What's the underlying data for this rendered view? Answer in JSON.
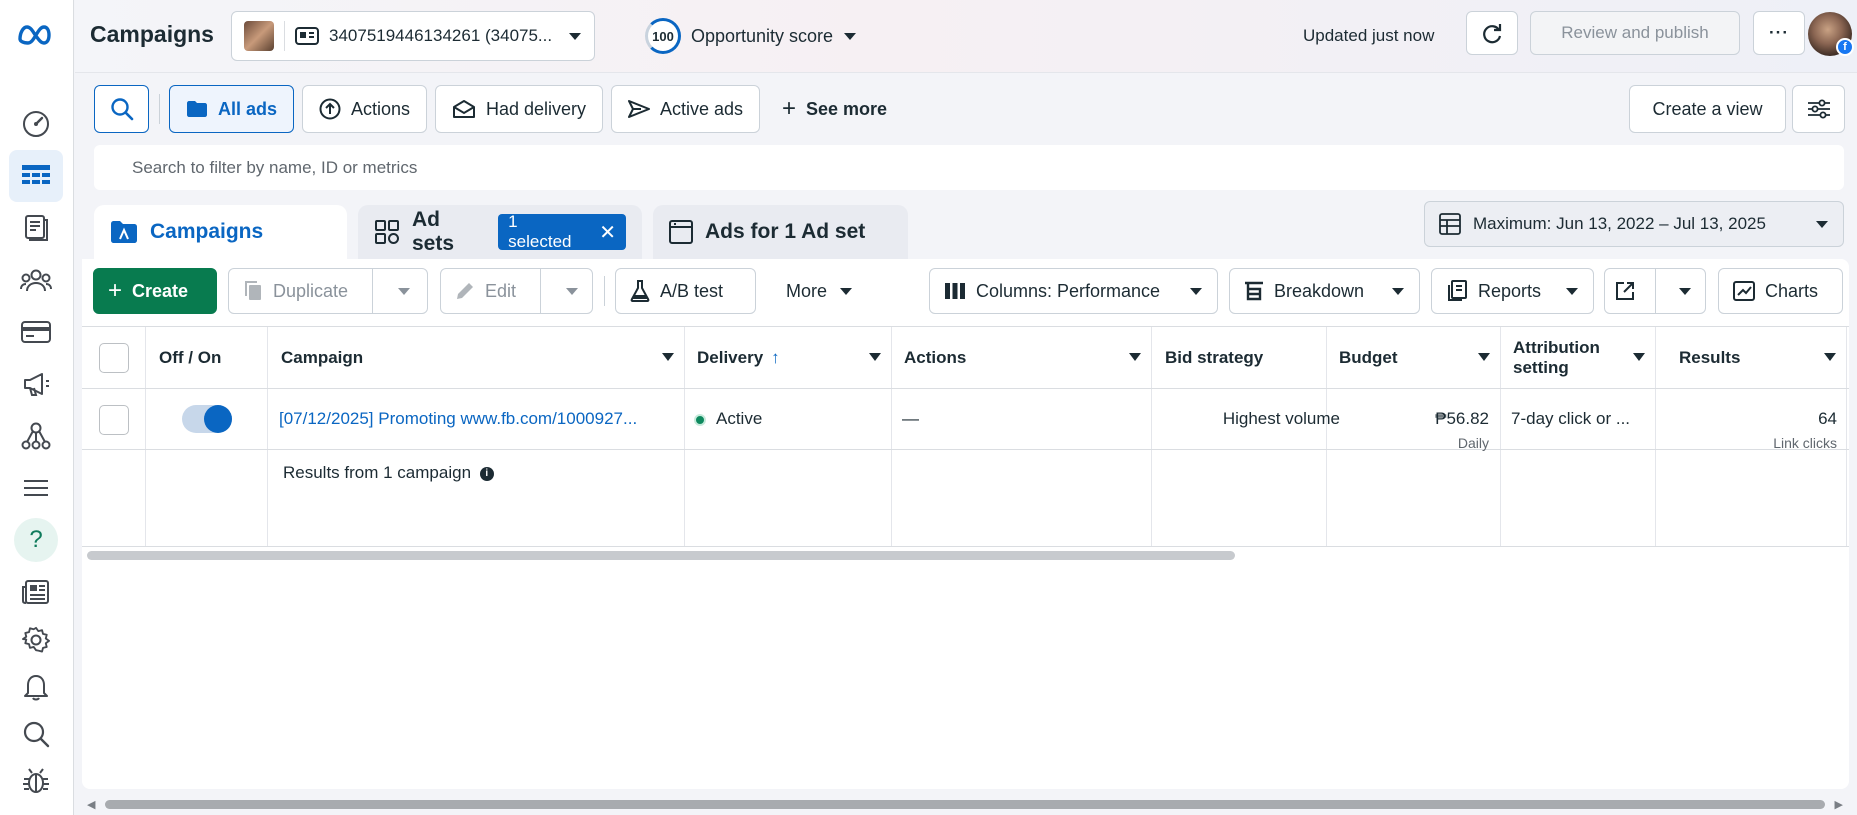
{
  "header": {
    "title": "Campaigns",
    "account_id": "3407519446134261 (34075...",
    "opportunity_score": "100",
    "opportunity_label": "Opportunity score",
    "updated_text": "Updated just now",
    "review_publish_label": "Review and publish",
    "more_label": "···"
  },
  "filters": {
    "all_ads": "All ads",
    "actions": "Actions",
    "had_delivery": "Had delivery",
    "active_ads": "Active ads",
    "see_more": "See more",
    "create_view": "Create a view",
    "search_placeholder": "Search to filter by name, ID or metrics"
  },
  "tabs": {
    "campaigns": "Campaigns",
    "ad_sets": "Ad sets",
    "selected_badge": "1 selected",
    "ads": "Ads for 1 Ad set",
    "date_range": "Maximum: Jun 13, 2022 – Jul 13, 2025"
  },
  "toolbar": {
    "create": "Create",
    "duplicate": "Duplicate",
    "edit": "Edit",
    "ab_test": "A/B test",
    "more": "More",
    "columns": "Columns: Performance",
    "breakdown": "Breakdown",
    "reports": "Reports",
    "charts": "Charts"
  },
  "table": {
    "headers": {
      "off_on": "Off / On",
      "campaign": "Campaign",
      "delivery": "Delivery",
      "delivery_sort": "↑",
      "actions": "Actions",
      "bid_strategy": "Bid strategy",
      "budget": "Budget",
      "attribution": "Attribution setting",
      "results": "Results"
    },
    "rows": [
      {
        "toggle_on": true,
        "campaign": "[07/12/2025] Promoting www.fb.com/1000927...",
        "delivery": "Active",
        "actions": "—",
        "bid_strategy": "Highest volume",
        "budget": "₱56.82",
        "budget_sub": "Daily",
        "attribution": "7-day click or ...",
        "results": "64",
        "results_sub": "Link clicks"
      }
    ],
    "summary_text": "Results from 1 campaign",
    "summary_info": "i"
  },
  "colors": {
    "accent": "#0a66c2",
    "create_green": "#087b4f",
    "active_green": "#0f8a5f"
  },
  "icons": {
    "rail": [
      "meta-logo-icon",
      "dashboard-icon",
      "table-icon",
      "catalog-icon",
      "audience-icon",
      "billing-icon",
      "megaphone-icon",
      "graph-icon",
      "menu-icon",
      "help-icon",
      "news-icon",
      "settings-icon",
      "bell-icon",
      "search-icon",
      "bug-icon"
    ]
  }
}
